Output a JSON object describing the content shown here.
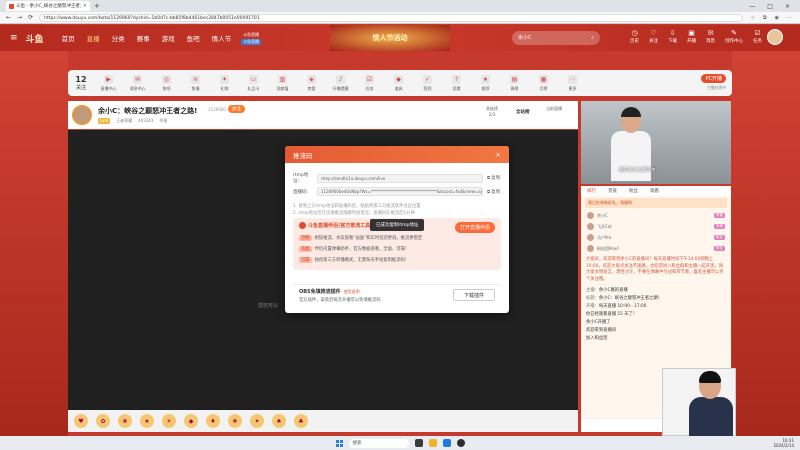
{
  "browser": {
    "tab_title": "斗鱼 - 余小C_峡谷之巅怒冲王者之路",
    "tab_close": "×",
    "new_tab": "+",
    "url": "https://www.douyu.com/beta/1126960?dyshid=1b0d7c-bb85f8b4461bec2847b0051e00091701",
    "nav_back": "←",
    "nav_forward": "→",
    "nav_refresh": "⟳",
    "win_min": "—",
    "win_max": "□",
    "win_close": "×"
  },
  "site": {
    "logo": "斗鱼",
    "nav": [
      "首页",
      "直播",
      "分类",
      "赛事",
      "游戏",
      "鱼吧",
      "情人节"
    ],
    "promo_line1": "斗鱼直播",
    "promo_tag": "斗鱼直播",
    "banner": "情人节活动",
    "search_placeholder": "余小C",
    "header_right": [
      "历史",
      "关注",
      "下载",
      "开播",
      "消息",
      "创作中心",
      "任务"
    ]
  },
  "catbar": {
    "count_num": "12",
    "count_label": "关注",
    "items": [
      "直播中心",
      "消息中心",
      "鱼吧",
      "鱼塘",
      "礼物",
      "礼品卡",
      "贡献值",
      "房管",
      "开播提醒",
      "任务",
      "道具",
      "签到",
      "竞猜",
      "推荐",
      "周榜",
      "月榜",
      "更多"
    ],
    "pc_live": "PC开播",
    "pc_sub": "主播在线中"
  },
  "stream": {
    "title": "余小C：峡谷之巅怒冲王者之路!",
    "level": "Lv.8",
    "category": "王者荣耀",
    "hot": "443343",
    "report": "举报",
    "room_id": "1126960",
    "follow": "关注",
    "rank_label": "贵族榜",
    "rank_value": "2/3",
    "rank2": "全站榜",
    "rank3": "当前直播"
  },
  "video_hint": "您还可以",
  "cam_subtitle": "我在峡谷之巅等你",
  "chat": {
    "tabs": [
      "排行",
      "贵族",
      "粉丝",
      "观看"
    ],
    "promo": "周日在线有好礼，领福利",
    "fans": [
      {
        "name": "余小C",
        "badge": "房管"
      },
      {
        "name": "飞天Cat",
        "badge": "贵族"
      },
      {
        "name": "马户Pro",
        "badge": "粉丝"
      },
      {
        "name": "粉丝团Pearl",
        "badge": "粉丝"
      }
    ],
    "announce": "大家好，欢迎来到余小C的直播间！每天直播时间下午14:00到晚上10:00，欢迎大家点关注不迷路，也欢迎进入粉丝群和主播一起开黑，请大家文明发言，理性讨论，不要在弹幕中引战和带节奏，喜欢主播可以点个关注哦。",
    "lines": [
      {
        "k": "主播：",
        "v": "余小C嘉的直播"
      },
      {
        "k": "标题：",
        "v": "余小C：峡谷之巅怒冲王者之路!"
      },
      {
        "k": "开播：",
        "v": "每天直播 10:00 - 17:00"
      }
    ],
    "bottom_msgs": [
      "你已经观看直播 15 天了！",
      "余小C开播了",
      "欢迎来到直播间",
      "加入粉丝团"
    ]
  },
  "modal": {
    "title": "推流码",
    "close": "×",
    "rtmp_label": "rtmp地址:",
    "rtmp_value": "rtmp://sendtx1a.douyu.com/live",
    "code_label": "直播码:",
    "code_value": "1126960bedUsNbp?Ws=*********************************&txcost=fxd&rnew=aj",
    "copy": "复制",
    "note1": "1. 复制上方rtmp地址和直播码后，粘贴到第三方推流软件对应位置",
    "note2": "2. rtmp地址仅在切换推流线路时会变化，直播码在推流后5分钟",
    "toast": "已成功复制rtmp地址",
    "tool_title": "斗鱼直播伴侣(官方推流工具)",
    "tool_btn": "打开直播伴侣",
    "tool_items": [
      {
        "tag": "流畅",
        "text": "相较推流，水友观看“画面”和实时延迟更低，推流更稳定"
      },
      {
        "tag": "功能",
        "text": "伴侣内置弹幕助手，官方数据查看，全面、可靠!"
      },
      {
        "tag": "可靠",
        "text": "独创第三方转播模式，无需每天手动复制推流码!"
      }
    ],
    "obs_title": "OBS免填推流插件",
    "obs_link": "使用说明",
    "obs_desc": "官方插件，安装后每次开播可以免填推流码",
    "obs_btn": "下载插件"
  },
  "taskbar": {
    "search": "搜索",
    "time": "16:31",
    "date": "2024/2/14"
  }
}
